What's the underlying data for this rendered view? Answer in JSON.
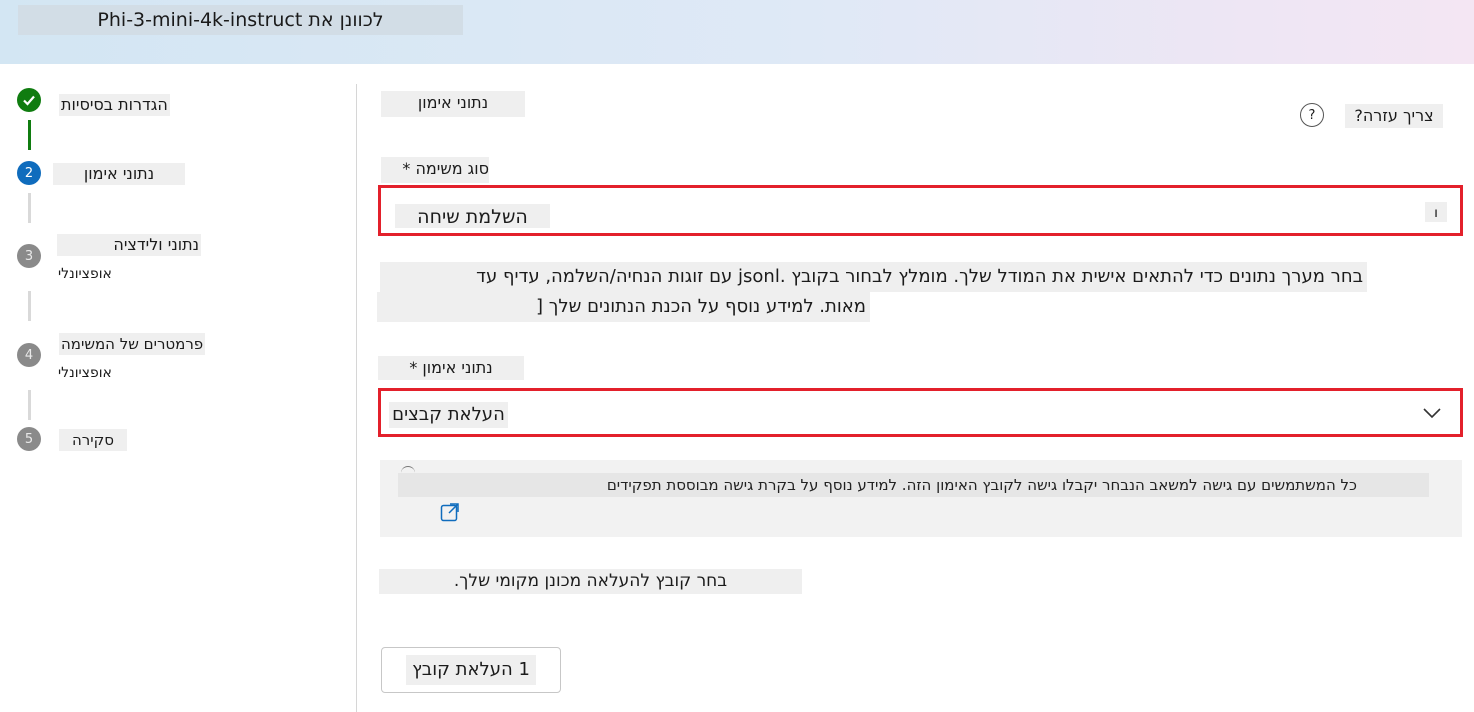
{
  "header": {
    "title_text": "לכוונן את ",
    "title_model": "Phi-3-mini-4k-instruct"
  },
  "steps": [
    {
      "number": "✓",
      "label": "הגדרות בסיסיות",
      "sub": "",
      "state": "done"
    },
    {
      "number": "2",
      "label": "נתוני אימון",
      "sub": "",
      "state": "active"
    },
    {
      "number": "3",
      "label": "נתוני ולידציה",
      "sub": "אופציונלי",
      "state": "pending"
    },
    {
      "number": "4",
      "label": "פרמטרים של המשימה",
      "sub": "אופציונלי",
      "state": "pending"
    },
    {
      "number": "5",
      "label": "סקירה",
      "sub": "",
      "state": "pending"
    }
  ],
  "main": {
    "section_title": "נתוני אימון",
    "help_text": "צריך עזרה?",
    "help_icon": "?",
    "task_type_label": "סוג משימה *",
    "task_type_value": "השלמת שיחה",
    "task_type_indicator": "ו",
    "description_line1": "בחר מערך נתונים כדי להתאים אישית את המודל שלך. מומלץ לבחור בקובץ .jsonl עם זוגות הנחיה/השלמה, עדיף עד",
    "description_line2": "מאות. למידע נוסף על הכנת הנתונים שלך [",
    "training_data_label": "נתוני אימון *",
    "training_data_value": "העלאת קבצים",
    "info_text": "כל המשתמשים עם גישה למשאב הנבחר יקבלו גישה לקובץ האימון הזה. למידע נוסף על בקרת גישה מבוססת תפקידים",
    "upload_hint": "בחר קובץ להעלאה מכונן מקומי שלך.",
    "upload_button": "1 העלאת קובץ"
  },
  "colors": {
    "accent": "#0f6cbd",
    "success": "#107c10",
    "highlight_border": "#e3202b"
  }
}
